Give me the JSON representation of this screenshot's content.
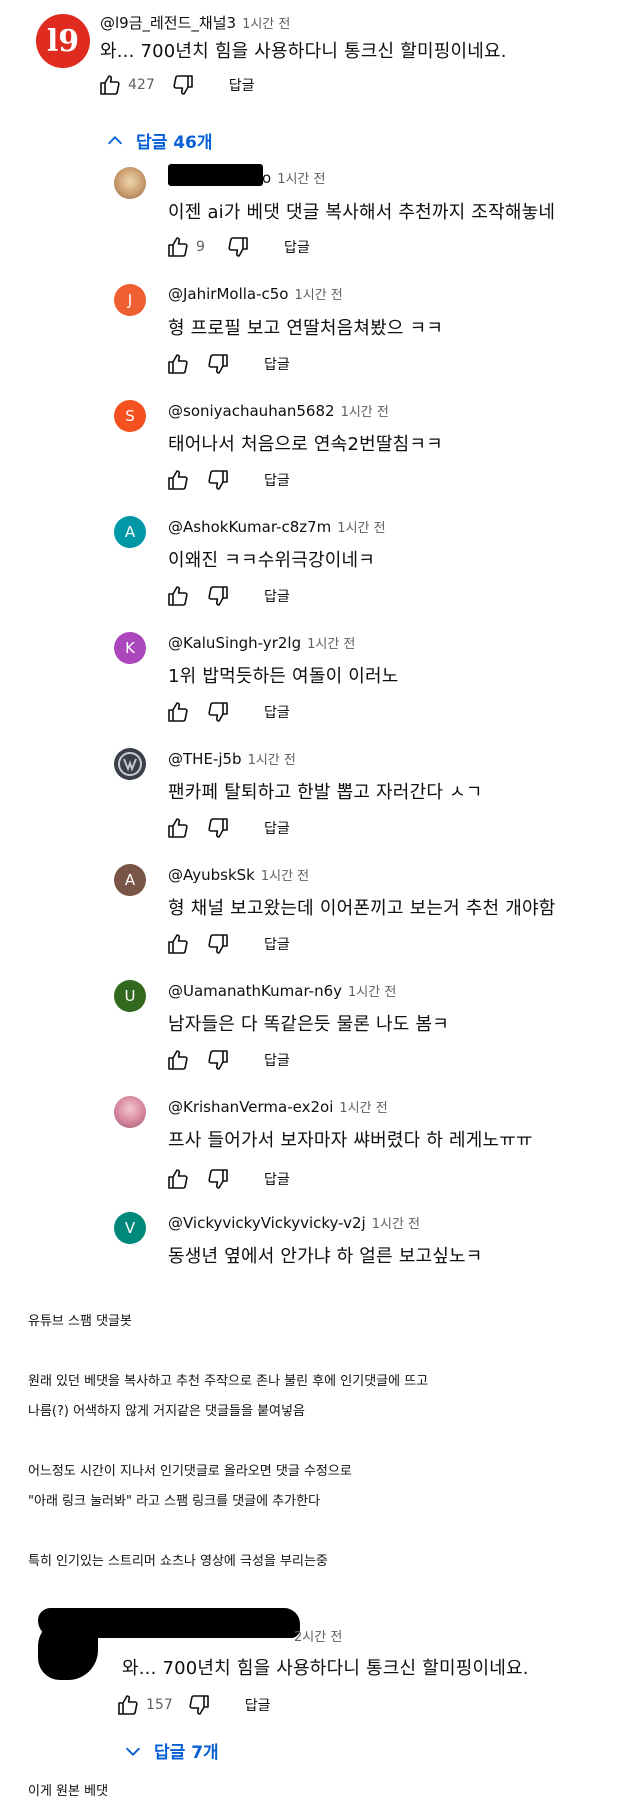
{
  "top_comment": {
    "avatar_text": "l9",
    "handle": "@l9금_레전드_채널3",
    "time": "1시간 전",
    "text": "와... 700년치 힘을 사용하다니 통크신 할미핑이네요.",
    "likes": "427",
    "reply_label": "답글",
    "replies_toggle": "답글 46개"
  },
  "replies": [
    {
      "handle": "o",
      "time": "1시간 전",
      "text": "이젠 ai가 베댓 댓글 복사해서 추천까지 조작해놓네",
      "likes": "9",
      "reply_label": "답글",
      "avatar_color": "#caa77c",
      "avatar_letter": ""
    },
    {
      "handle": "@JahirMolla-c5o",
      "time": "1시간 전",
      "text": "형 프로필 보고 연딸처음쳐봤으 ㅋㅋ",
      "likes": "",
      "reply_label": "답글",
      "avatar_color": "#ef5f32",
      "avatar_letter": "J"
    },
    {
      "handle": "@soniyachauhan5682",
      "time": "1시간 전",
      "text": "태어나서 처음으로 연속2번딸침ㅋㅋ",
      "likes": "",
      "reply_label": "답글",
      "avatar_color": "#f4511e",
      "avatar_letter": "S"
    },
    {
      "handle": "@AshokKumar-c8z7m",
      "time": "1시간 전",
      "text": "이왜진 ㅋㅋ수위극강이네ㅋ",
      "likes": "",
      "reply_label": "답글",
      "avatar_color": "#0097a7",
      "avatar_letter": "A"
    },
    {
      "handle": "@KaluSingh-yr2lg",
      "time": "1시간 전",
      "text": "1위 밥먹듯하든 여돌이 이러노",
      "likes": "",
      "reply_label": "답글",
      "avatar_color": "#ab47bc",
      "avatar_letter": "K"
    },
    {
      "handle": "@THE-j5b",
      "time": "1시간 전",
      "text": "팬카페 탈퇴하고 한발 뽑고 자러간다 ㅅㄱ",
      "likes": "",
      "reply_label": "답글",
      "avatar_color": "#3a3f4a",
      "avatar_letter": ""
    },
    {
      "handle": "@AyubskSk",
      "time": "1시간 전",
      "text": "형 채널 보고왔는데 이어폰끼고 보는거 추천 개야함",
      "likes": "",
      "reply_label": "답글",
      "avatar_color": "#795548",
      "avatar_letter": "A"
    },
    {
      "handle": "@UamanathKumar-n6y",
      "time": "1시간 전",
      "text": "남자들은 다 똑같은듯 물론 나도 봄ㅋ",
      "likes": "",
      "reply_label": "답글",
      "avatar_color": "#33691e",
      "avatar_letter": "U"
    },
    {
      "handle": "@KrishanVerma-ex2oi",
      "time": "1시간 전",
      "text": "프사 들어가서 보자마자 쌰버렸다 하 레게노ㅠㅠ",
      "likes": "",
      "reply_label": "답글",
      "avatar_color": "#d9a7b5",
      "avatar_letter": ""
    },
    {
      "handle": "@VickyvickyVickyvicky-v2j",
      "time": "1시간 전",
      "text": "동생년 옆에서 안가냐 하 얼른 보고싶노ㅋ",
      "likes": "",
      "reply_label": "답글",
      "avatar_color": "#00897b",
      "avatar_letter": "V"
    }
  ],
  "notes": {
    "title": "유튜브 스팸 댓글봇",
    "p1_line1": "원래 있던 베댓을 복사하고 추천 주작으로 존나 불린 후에 인기댓글에 뜨고",
    "p1_line2": "나름(?) 어색하지 않게 거지같은 댓글들을 붙여넣음",
    "p2_line1": "어느정도 시간이 지나서 인기댓글로 올라오면 댓글 수정으로",
    "p2_line2": "\"아래 링크 눌러봐\" 라고 스팸 링크를 댓글에 추가한다",
    "p3": "특히 인기있는 스트리머 쇼츠나 영상에 극성을 부리는중"
  },
  "original_comment": {
    "time": "2시간 전",
    "text": "와... 700년치 힘을 사용하다니 통크신 할미핑이네요.",
    "likes": "157",
    "reply_label": "답글",
    "replies_toggle": "답글 7개"
  },
  "footer_note": "이게 원본 베댓"
}
